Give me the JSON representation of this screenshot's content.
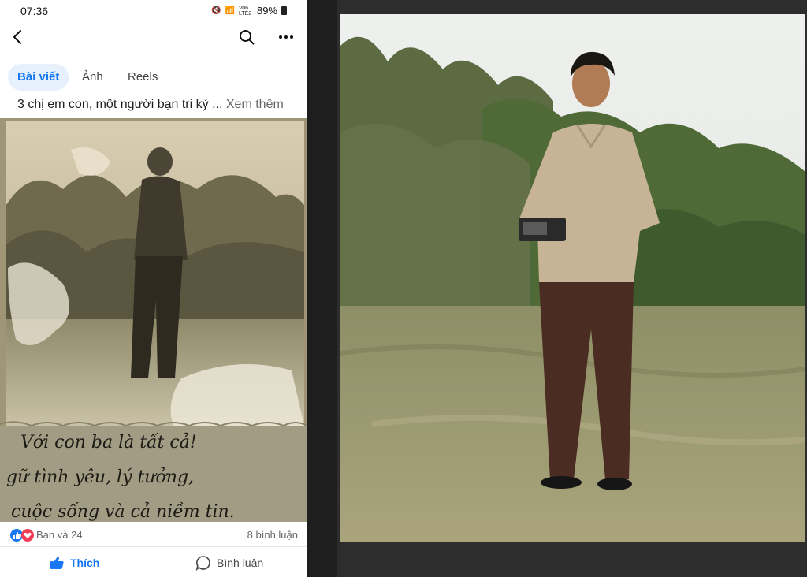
{
  "status_bar": {
    "time": "07:36",
    "network_label": "Vo6 LTE2",
    "battery": "89%"
  },
  "tabs": [
    {
      "label": "Bài viết",
      "active": true
    },
    {
      "label": "Ảnh",
      "active": false
    },
    {
      "label": "Reels",
      "active": false
    }
  ],
  "post": {
    "caption": "3 chị em con, một người bạn tri kỷ ...",
    "see_more": "Xem thêm",
    "handwriting": [
      "Với con ba là tất cả!",
      "gữ tình yêu, lý tưởng,",
      "cuộc sống và cả niềm tin."
    ],
    "reactions_text": "Bạn và 24",
    "comments_count": "8 bình luận",
    "like_label": "Thích",
    "comment_label": "Bình luận"
  },
  "colors": {
    "fb_blue": "#1877f2",
    "tab_active_bg": "#e7f0fd",
    "muted_text": "#65676b"
  }
}
